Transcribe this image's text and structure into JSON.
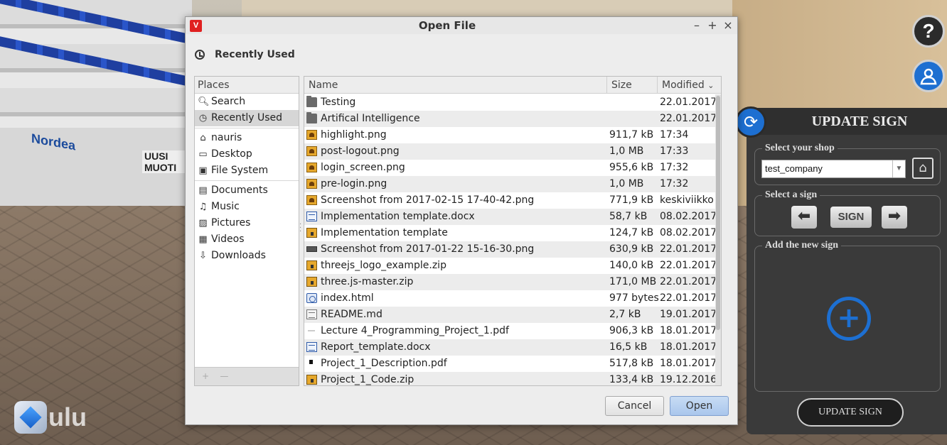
{
  "background": {
    "signs": [
      "Nordea",
      "UUSI MUOTI"
    ],
    "logo_text": "ulu"
  },
  "dialog": {
    "title": "Open File",
    "app_icon_letter": "V",
    "controls": {
      "minimize": "–",
      "maximize": "+",
      "close": "×"
    },
    "location_label": "Recently Used",
    "places_header": "Places",
    "places": [
      {
        "label": "Search",
        "icon": "search-icon"
      },
      {
        "label": "Recently Used",
        "icon": "clock-icon",
        "selected": true
      },
      {
        "label": "nauris",
        "icon": "home-icon"
      },
      {
        "label": "Desktop",
        "icon": "desktop-icon"
      },
      {
        "label": "File System",
        "icon": "drive-icon"
      },
      {
        "label": "Documents",
        "icon": "documents-icon"
      },
      {
        "label": "Music",
        "icon": "music-icon"
      },
      {
        "label": "Pictures",
        "icon": "pictures-icon"
      },
      {
        "label": "Videos",
        "icon": "videos-icon"
      },
      {
        "label": "Downloads",
        "icon": "downloads-icon"
      }
    ],
    "columns": {
      "name": "Name",
      "size": "Size",
      "modified": "Modified"
    },
    "files": [
      {
        "name": "Testing",
        "size": "",
        "modified": "22.01.2017",
        "type": "folder"
      },
      {
        "name": "Artifical Intelligence",
        "size": "",
        "modified": "22.01.2017",
        "type": "folder"
      },
      {
        "name": "highlight.png",
        "size": "911,7 kB",
        "modified": "17:34",
        "type": "image"
      },
      {
        "name": "post-logout.png",
        "size": "1,0 MB",
        "modified": "17:33",
        "type": "image"
      },
      {
        "name": "login_screen.png",
        "size": "955,6 kB",
        "modified": "17:32",
        "type": "image"
      },
      {
        "name": "pre-login.png",
        "size": "1,0 MB",
        "modified": "17:32",
        "type": "image"
      },
      {
        "name": "Screenshot from 2017-02-15 17-40-42.png",
        "size": "771,9 kB",
        "modified": "keskiviikko",
        "type": "image"
      },
      {
        "name": "Implementation template.docx",
        "size": "58,7 kB",
        "modified": "08.02.2017",
        "type": "doc"
      },
      {
        "name": "Implementation template",
        "size": "124,7 kB",
        "modified": "08.02.2017",
        "type": "archive"
      },
      {
        "name": "Screenshot from 2017-01-22 15-16-30.png",
        "size": "630,9 kB",
        "modified": "22.01.2017",
        "type": "photo"
      },
      {
        "name": "threejs_logo_example.zip",
        "size": "140,0 kB",
        "modified": "22.01.2017",
        "type": "archive"
      },
      {
        "name": "three.js-master.zip",
        "size": "171,0 MB",
        "modified": "22.01.2017",
        "type": "archive"
      },
      {
        "name": "index.html",
        "size": "977 bytes",
        "modified": "22.01.2017",
        "type": "html"
      },
      {
        "name": "README.md",
        "size": "2,7 kB",
        "modified": "19.01.2017",
        "type": "text"
      },
      {
        "name": "Lecture 4_Programming_Project_1.pdf",
        "size": "906,3 kB",
        "modified": "18.01.2017",
        "type": "pdfblank"
      },
      {
        "name": "Report_template.docx",
        "size": "16,5 kB",
        "modified": "18.01.2017",
        "type": "doc"
      },
      {
        "name": "Project_1_Description.pdf",
        "size": "517,8 kB",
        "modified": "18.01.2017",
        "type": "pdf"
      },
      {
        "name": "Project_1_Code.zip",
        "size": "133,4 kB",
        "modified": "19.12.2016",
        "type": "archive"
      }
    ],
    "buttons": {
      "cancel": "Cancel",
      "open": "Open"
    }
  },
  "panel": {
    "help_label": "?",
    "title": "UPDATE SIGN",
    "shop_legend": "Select your shop",
    "shop_value": "test_company",
    "sign_legend": "Select a sign",
    "sign_button": "SIGN",
    "add_legend": "Add the new sign",
    "update_button": "UPDATE SIGN",
    "accent": "#1d6fd1"
  }
}
